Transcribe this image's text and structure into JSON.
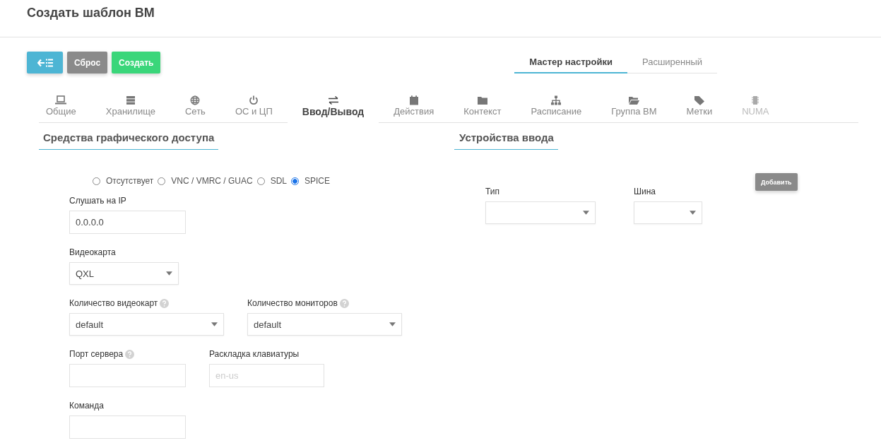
{
  "page": {
    "title": "Создать шаблон ВМ"
  },
  "toolbar": [
    {
      "kind": "back"
    },
    {
      "kind": "reset",
      "label": "Сброс"
    },
    {
      "kind": "create",
      "label": "Создать"
    }
  ],
  "mode_tabs": [
    {
      "label": "Мастер настройки",
      "selected": true
    },
    {
      "label": "Расширенный",
      "selected": false
    }
  ],
  "tabs": [
    {
      "label": "Общие",
      "selected": false,
      "disabled": false
    },
    {
      "label": "Хранилище",
      "selected": false,
      "disabled": false
    },
    {
      "label": "Сеть",
      "selected": false,
      "disabled": false
    },
    {
      "label": "ОС и ЦП",
      "selected": false,
      "disabled": false
    },
    {
      "label": "Ввод/Вывод",
      "selected": true,
      "disabled": false
    },
    {
      "label": "Действия",
      "selected": false,
      "disabled": false
    },
    {
      "label": "Контекст",
      "selected": false,
      "disabled": false
    },
    {
      "label": "Расписание",
      "selected": false,
      "disabled": false
    },
    {
      "label": "Группа ВМ",
      "selected": false,
      "disabled": false
    },
    {
      "label": "Метки",
      "selected": false,
      "disabled": false
    },
    {
      "label": "NUMA",
      "selected": false,
      "disabled": true
    }
  ],
  "graphics": {
    "title": "Средства графического доступа",
    "options": [
      {
        "label": "Отсутствует",
        "selected": false
      },
      {
        "label": "VNC / VMRC / GUAC",
        "selected": false
      },
      {
        "label": "SDL",
        "selected": false
      },
      {
        "label": "SPICE",
        "selected": true
      }
    ],
    "rows": [
      [
        {
          "label": "Слушать на IP",
          "kind": "text",
          "value": "0.0.0.0",
          "help": false
        }
      ],
      [
        {
          "label": "Видеокарта",
          "kind": "select",
          "value": "QXL",
          "help": false
        }
      ],
      [
        {
          "label": "Количество видеокарт",
          "kind": "select",
          "value": "default",
          "help": true
        },
        {
          "label": "Количество мониторов",
          "kind": "select",
          "value": "default",
          "help": true
        }
      ],
      [
        {
          "label": "Порт сервера",
          "kind": "text",
          "help": true
        },
        {
          "label": "Раскладка клавиатуры",
          "kind": "text",
          "placeholder": "en-us",
          "help": false
        }
      ],
      [
        {
          "label": "Команда",
          "kind": "text",
          "help": false
        }
      ]
    ]
  },
  "input_devices": {
    "title": "Устройства ввода",
    "fields": [
      {
        "label": "Тип",
        "kind": "select"
      },
      {
        "label": "Шина",
        "kind": "select"
      }
    ],
    "add_button": "Добавить"
  }
}
